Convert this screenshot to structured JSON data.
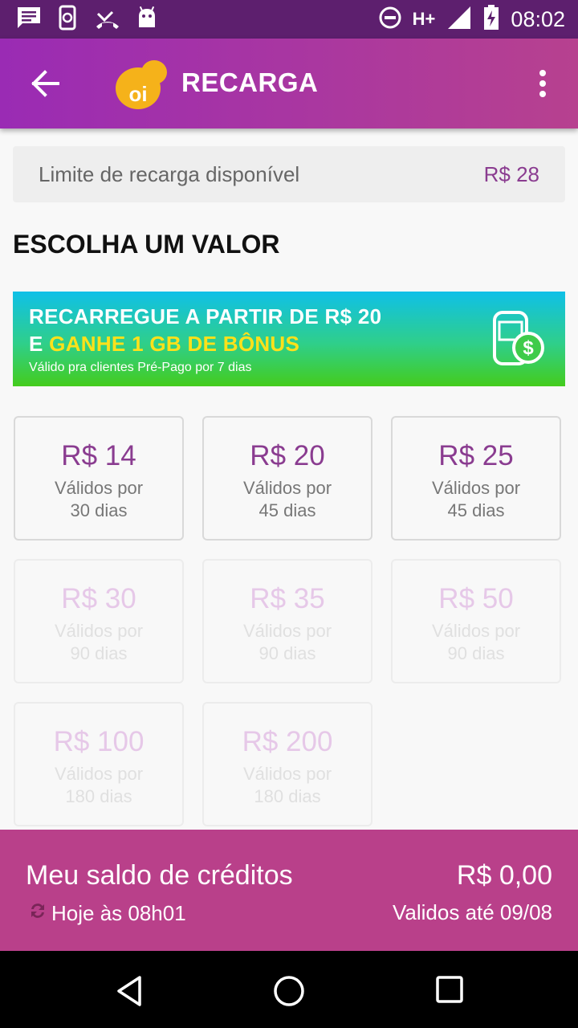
{
  "status_bar": {
    "time": "08:02",
    "network": "H+"
  },
  "app_bar": {
    "title": "RECARGA",
    "logo_text": "oi"
  },
  "limit": {
    "label": "Limite de recarga disponível",
    "value": "R$ 28"
  },
  "section_title": "ESCOLHA UM VALOR",
  "banner": {
    "line1": "RECARREGUE A PARTIR DE R$ 20",
    "line2_prefix": "E ",
    "line2_highlight": "GANHE 1 GB DE BÔNUS",
    "subtitle": "Válido pra clientes Pré-Pago por 7 dias"
  },
  "options": [
    {
      "price": "R$ 14",
      "line1": "Válidos por",
      "line2": "30 dias",
      "enabled": true
    },
    {
      "price": "R$ 20",
      "line1": "Válidos por",
      "line2": "45 dias",
      "enabled": true
    },
    {
      "price": "R$ 25",
      "line1": "Válidos por",
      "line2": "45 dias",
      "enabled": true
    },
    {
      "price": "R$ 30",
      "line1": "Válidos por",
      "line2": "90 dias",
      "enabled": false
    },
    {
      "price": "R$ 35",
      "line1": "Válidos por",
      "line2": "90 dias",
      "enabled": false
    },
    {
      "price": "R$ 50",
      "line1": "Válidos por",
      "line2": "90 dias",
      "enabled": false
    },
    {
      "price": "R$ 100",
      "line1": "Válidos por",
      "line2": "180 dias",
      "enabled": false
    },
    {
      "price": "R$ 200",
      "line1": "Válidos por",
      "line2": "180 dias",
      "enabled": false
    }
  ],
  "footer": {
    "label": "Meu saldo de créditos",
    "amount": "R$ 0,00",
    "updated": "Hoje às 08h01",
    "valid_until": "Validos até 09/08"
  },
  "colors": {
    "brand_purple": "#8a3c90",
    "footer": "#b9408a",
    "logo": "#f5b21a"
  }
}
